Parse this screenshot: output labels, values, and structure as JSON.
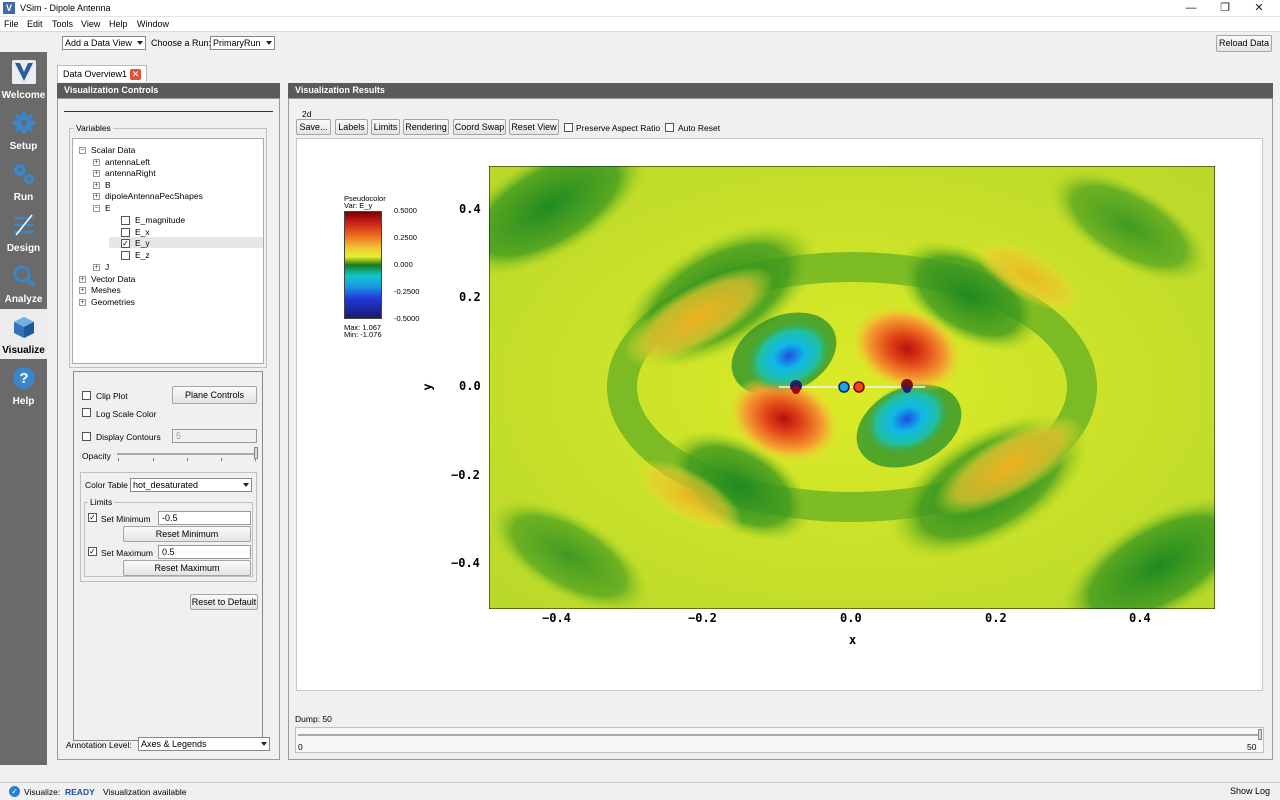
{
  "window": {
    "title": "VSim - Dipole Antenna",
    "controls": [
      "—",
      "❐",
      "✕"
    ]
  },
  "menu": [
    "File",
    "Edit",
    "Tools",
    "View",
    "Help",
    "Window"
  ],
  "nav": [
    {
      "label": "Welcome",
      "icon": "vsim-logo-icon"
    },
    {
      "label": "Setup",
      "icon": "gear-icon"
    },
    {
      "label": "Run",
      "icon": "gears-icon"
    },
    {
      "label": "Design",
      "icon": "design-icon"
    },
    {
      "label": "Analyze",
      "icon": "magnifier-icon"
    },
    {
      "label": "Visualize",
      "icon": "cube-icon",
      "active": true
    },
    {
      "label": "Help",
      "icon": "help-icon"
    }
  ],
  "toolbar": {
    "add_data_view": "Add a Data View",
    "choose_run_label": "Choose a Run:",
    "run_value": "PrimaryRun",
    "reload": "Reload Data"
  },
  "tab": {
    "label": "Data Overview1"
  },
  "controls": {
    "header": "Visualization Controls",
    "variables_title": "Variables",
    "tree": {
      "scalar": "Scalar Data",
      "items": [
        "antennaLeft",
        "antennaRight",
        "B",
        "dipoleAntennaPecShapes",
        "E"
      ],
      "e_children": [
        {
          "label": "E_magnitude",
          "checked": false
        },
        {
          "label": "E_x",
          "checked": false
        },
        {
          "label": "E_y",
          "checked": true
        },
        {
          "label": "E_z",
          "checked": false
        }
      ],
      "after": [
        "J",
        "Vector Data",
        "Meshes",
        "Geometries"
      ]
    },
    "clip_plot": "Clip Plot",
    "plane_controls": "Plane Controls",
    "log_scale": "Log Scale Color",
    "display_contours": "Display Contours",
    "contours_value": "5",
    "opacity": "Opacity",
    "color_table_label": "Color Table",
    "color_table_value": "hot_desaturated",
    "limits_title": "Limits",
    "set_min": "Set Minimum",
    "min_value": "-0.5",
    "reset_min": "Reset Minimum",
    "set_max": "Set Maximum",
    "max_value": "0.5",
    "reset_max": "Reset Maximum",
    "reset_default": "Reset to Default",
    "annotation_label": "Annotation Level:",
    "annotation_value": "Axes & Legends"
  },
  "results": {
    "header": "Visualization Results",
    "group": "2d",
    "buttons": [
      "Save...",
      "Labels",
      "Limits",
      "Rendering",
      "Coord Swap",
      "Reset View"
    ],
    "preserve": "Preserve Aspect Ratio",
    "auto_reset": "Auto Reset",
    "dump_label": "Dump: 50",
    "dump_min": "0",
    "dump_max": "50"
  },
  "legend": {
    "title": "Pseudocolor",
    "var": "Var: E_y",
    "ticks": [
      "0.5000",
      "0.2500",
      "0.000",
      "-0.2500",
      "-0.5000"
    ],
    "max": "Max:  1.067",
    "min": "Min: -1.076"
  },
  "plot": {
    "xlabel": "x",
    "ylabel": "y",
    "xticks": [
      "−0.4",
      "−0.2",
      "0.0",
      "0.2",
      "0.4"
    ],
    "yticks": [
      "0.4",
      "0.2",
      "0.0",
      "−0.2",
      "−0.4"
    ]
  },
  "status": {
    "label": "Visualize:",
    "state": "READY",
    "message": "Visualization available",
    "show_log": "Show Log"
  },
  "colors": {
    "nav_bg": "#6a6a6a",
    "panel_header": "#5a5a5a",
    "ready": "#1a4fa0"
  }
}
